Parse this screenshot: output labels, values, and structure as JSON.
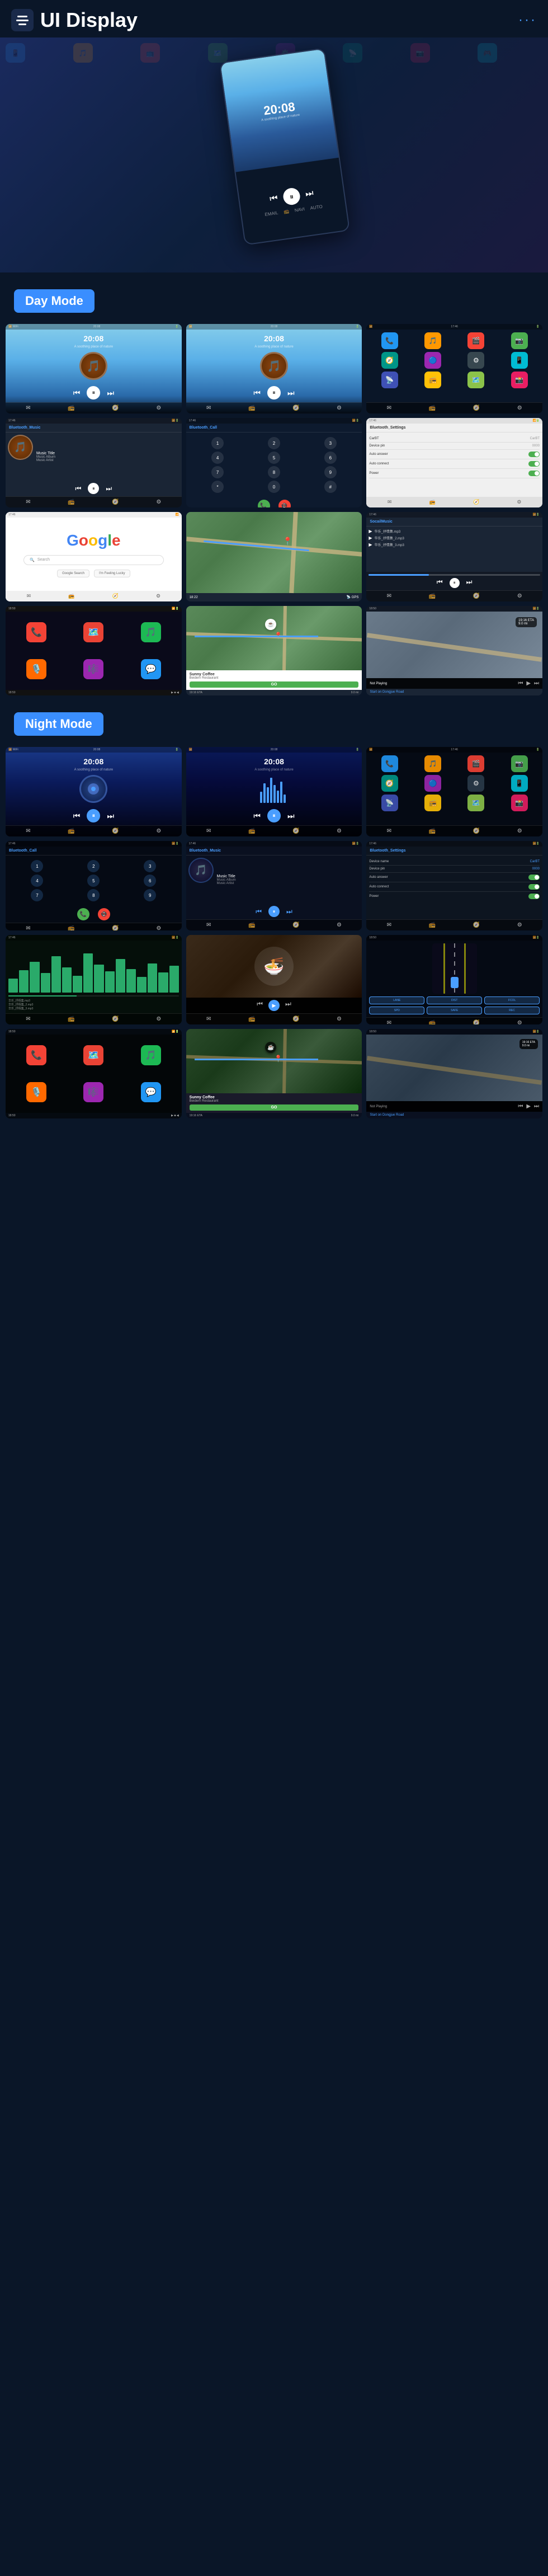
{
  "header": {
    "title": "UI Display",
    "menu_label": "menu",
    "dots_label": "more"
  },
  "sections": {
    "day_mode": "Day Mode",
    "night_mode": "Night Mode"
  },
  "screens": {
    "time": "20:08",
    "subtitle": "A soothing place of nature",
    "music_title": "Music Title",
    "music_album": "Music Album",
    "music_artist": "Music Artist",
    "bluetooth_music": "Bluetooth_Music",
    "bluetooth_call": "Bluetooth_Call",
    "bluetooth_settings": "Bluetooth_Settings",
    "device_name": "CarBT",
    "device_pin": "0000",
    "auto_answer": "Auto answer",
    "auto_connect": "Auto connect",
    "power": "Power",
    "local_music": "SocailMusic",
    "google": "Google",
    "sunny_coffee": "Sunny Coffee",
    "restaurant": "Beidern Restaurant",
    "go_btn": "GO",
    "eta_label": "19:16 ETA",
    "distance": "9.0 mi",
    "not_playing": "Not Playing",
    "start_on": "Start on Dongjue Road"
  },
  "dial_buttons": [
    "1",
    "2",
    "3",
    "4",
    "5",
    "6",
    "7",
    "8",
    "9",
    "*",
    "0",
    "#"
  ],
  "file_names": [
    "华乐_抒情集.mp3",
    "华乐_抒情集_2.mp3",
    "华乐_抒情集_3.mp3"
  ],
  "colors": {
    "accent_blue": "#3a8eff",
    "background_dark": "#0a1628",
    "card_bg": "#1a2535",
    "green_accent": "#2aaa6a",
    "text_muted": "rgba(255,255,255,0.5)"
  }
}
